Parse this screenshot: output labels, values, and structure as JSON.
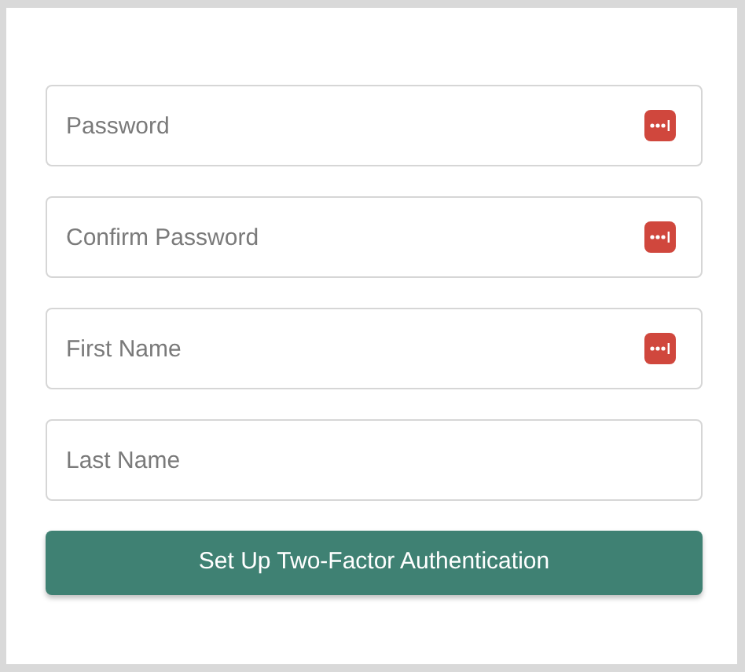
{
  "fields": [
    {
      "placeholder": "Password",
      "autofill_icon": true
    },
    {
      "placeholder": "Confirm Password",
      "autofill_icon": true
    },
    {
      "placeholder": "First Name",
      "autofill_icon": true
    },
    {
      "placeholder": "Last Name",
      "autofill_icon": false
    }
  ],
  "submit_button": {
    "label": "Set Up Two-Factor Authentication"
  }
}
